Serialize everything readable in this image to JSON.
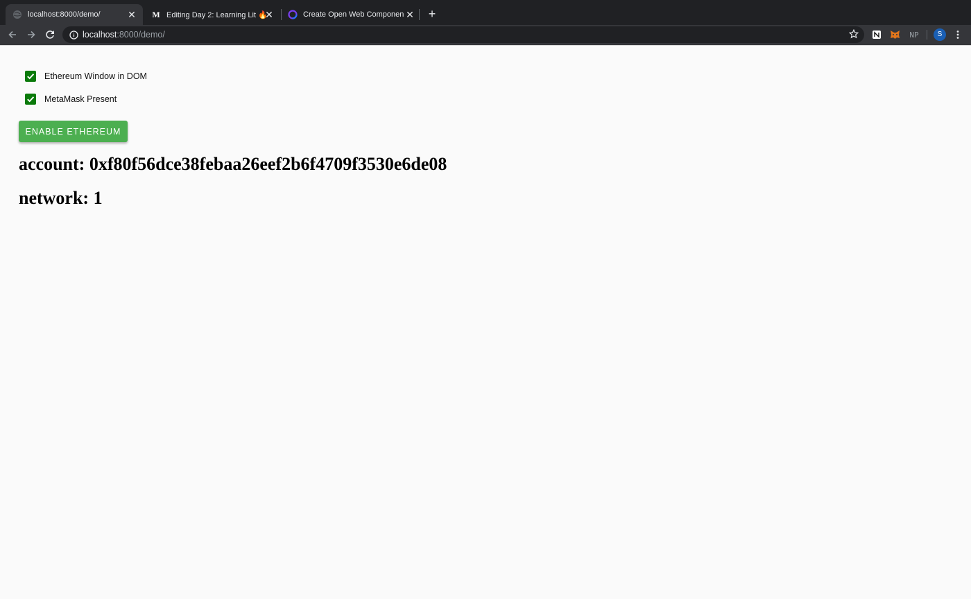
{
  "browser": {
    "tabs": [
      {
        "title": "localhost:8000/demo/",
        "icon": "globe-icon",
        "active": true
      },
      {
        "title": "Editing Day 2: Learning Lit 🔥 ...",
        "icon": "medium-logo-icon",
        "active": false
      },
      {
        "title": "Create Open Web Components",
        "icon": "open-wc-logo-icon",
        "active": false
      }
    ],
    "url_host": "localhost",
    "url_rest": ":8000/demo/",
    "extensions": [
      "notion-icon",
      "metamask-icon",
      "np-extension"
    ],
    "np_label": "NP",
    "avatar_letter": "S",
    "accent": "#1a5fb4"
  },
  "page": {
    "checks": [
      {
        "label": "Ethereum Window in DOM",
        "checked": true
      },
      {
        "label": "MetaMask Present",
        "checked": true
      }
    ],
    "enable_button": "ENABLE ETHEREUM",
    "account_line": "account: 0xf80f56dce38febaa26eef2b6f4709f3530e6de08",
    "network_line": "network: 1",
    "check_color": "#0a7a0a",
    "button_color": "#4caf50"
  }
}
